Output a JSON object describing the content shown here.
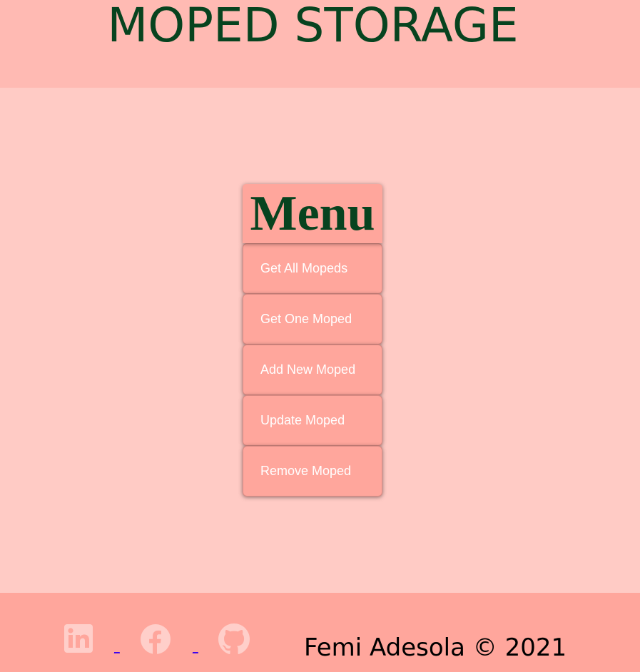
{
  "header": {
    "title": "MOPED STORAGE"
  },
  "menu": {
    "title": "Menu",
    "items": [
      {
        "label": "Get All Mopeds"
      },
      {
        "label": "Get One Moped"
      },
      {
        "label": "Add New Moped"
      },
      {
        "label": "Update Moped"
      },
      {
        "label": "Remove Moped"
      }
    ]
  },
  "footer": {
    "social": [
      {
        "icon": "linkedin-icon"
      },
      {
        "icon": "facebook-icon"
      },
      {
        "icon": "github-icon"
      }
    ],
    "separator": "_",
    "credit": "Femi Adesola © 2021"
  },
  "colors": {
    "header_bg": "#ffbab3",
    "page_bg": "#ffcbc5",
    "panel_bg": "#ffa69c",
    "title_green": "#07431f",
    "icon_tint": "#ffcfca"
  }
}
